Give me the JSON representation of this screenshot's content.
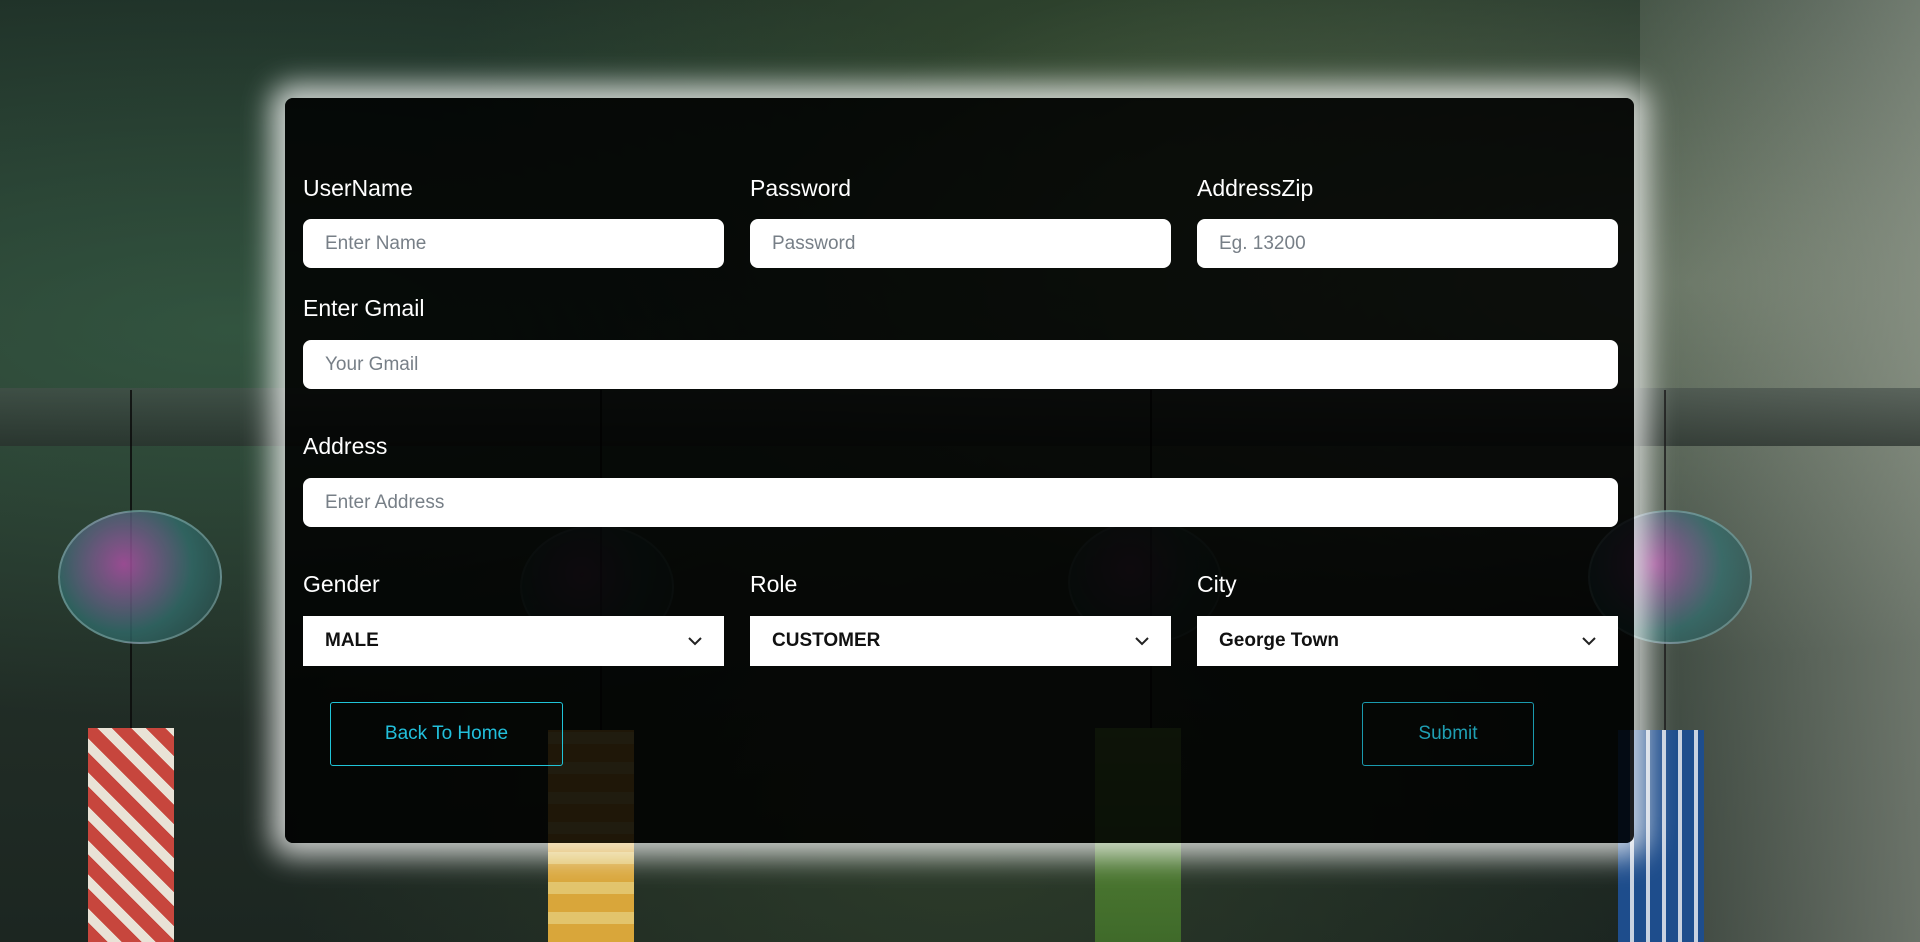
{
  "form": {
    "username": {
      "label": "UserName",
      "placeholder": "Enter Name",
      "value": ""
    },
    "password": {
      "label": "Password",
      "placeholder": "Password",
      "value": ""
    },
    "address_zip": {
      "label": "AddressZip",
      "placeholder": "Eg. 13200",
      "value": ""
    },
    "gmail": {
      "label": "Enter Gmail",
      "placeholder": "Your Gmail",
      "value": ""
    },
    "address": {
      "label": "Address",
      "placeholder": "Enter Address",
      "value": ""
    },
    "gender": {
      "label": "Gender",
      "selected": "MALE"
    },
    "role": {
      "label": "Role",
      "selected": "CUSTOMER"
    },
    "city": {
      "label": "City",
      "selected": "George Town"
    }
  },
  "actions": {
    "back_label": "Back To Home",
    "submit_label": "Submit"
  },
  "colors": {
    "accent": "#22c0dc",
    "card_background": "#000000",
    "card_glow": "#ffffff"
  },
  "icons": {
    "dropdown": "chevron-down-icon"
  }
}
